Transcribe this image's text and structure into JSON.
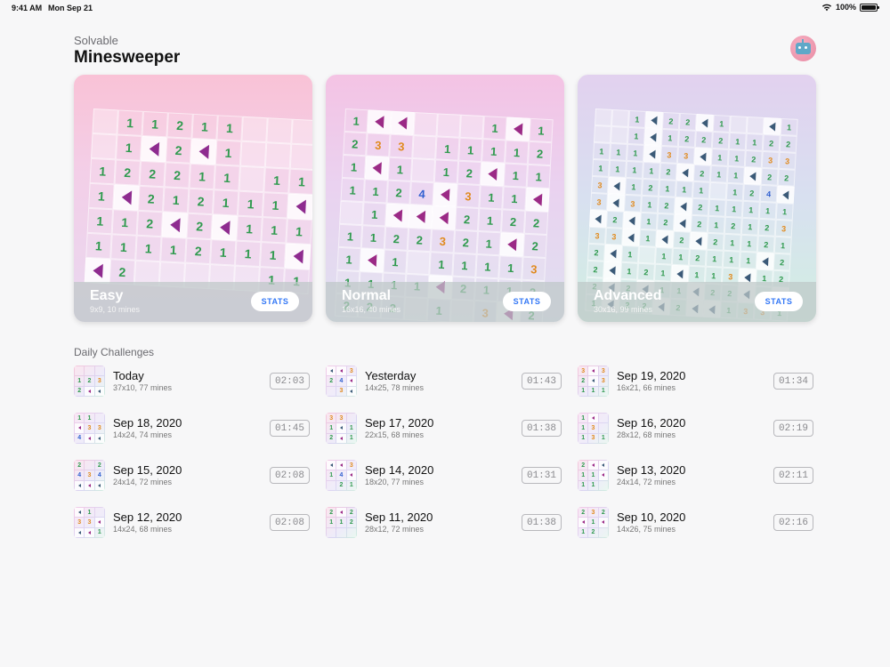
{
  "status_bar": {
    "time": "9:41 AM",
    "date": "Mon Sep 21",
    "battery": "100%"
  },
  "header": {
    "subtitle": "Solvable",
    "title": "Minesweeper"
  },
  "avatar": {
    "icon": "robot-icon"
  },
  "modes": [
    {
      "name": "Easy",
      "detail": "9x9, 10 mines",
      "stats_label": "STATS"
    },
    {
      "name": "Normal",
      "detail": "16x16, 40 mines",
      "stats_label": "STATS"
    },
    {
      "name": "Advanced",
      "detail": "30x16, 99 mines",
      "stats_label": "STATS"
    }
  ],
  "boards": [
    {
      "rows": [
        [
          "",
          "1",
          "1",
          "2",
          "1",
          "1",
          "",
          "",
          ""
        ],
        [
          "",
          "1",
          "F",
          "2",
          "F",
          "1",
          "",
          "",
          ""
        ],
        [
          "1",
          "2",
          "2",
          "2",
          "1",
          "1",
          "",
          "1",
          "1"
        ],
        [
          "1",
          "F",
          "2",
          "1",
          "2",
          "1",
          "1",
          "1",
          "F"
        ],
        [
          "1",
          "1",
          "2",
          "F",
          "2",
          "F",
          "1",
          "1",
          "1"
        ],
        [
          "1",
          "1",
          "1",
          "1",
          "2",
          "1",
          "1",
          "1",
          "F"
        ],
        [
          "F",
          "2",
          "",
          "",
          "",
          "",
          "",
          "1",
          "1"
        ]
      ]
    },
    {
      "rows": [
        [
          "1",
          "F",
          "F",
          "",
          "",
          "",
          "1",
          "F",
          "1"
        ],
        [
          "2",
          "3",
          "3",
          "",
          "1",
          "1",
          "1",
          "1",
          "2"
        ],
        [
          "1",
          "F",
          "1",
          "",
          "1",
          "2",
          "F",
          "1",
          "1"
        ],
        [
          "1",
          "1",
          "2",
          "4",
          "F",
          "3",
          "1",
          "1",
          "F"
        ],
        [
          "",
          "1",
          "F",
          "F",
          "F",
          "2",
          "1",
          "2",
          "2"
        ],
        [
          "1",
          "1",
          "2",
          "2",
          "3",
          "2",
          "1",
          "F",
          "2"
        ],
        [
          "1",
          "F",
          "1",
          "",
          "1",
          "1",
          "1",
          "1",
          "3"
        ],
        [
          "1",
          "1",
          "1",
          "1",
          "F",
          "2",
          "1",
          "1",
          "2"
        ],
        [
          "2",
          "2",
          "2",
          "",
          "1",
          "",
          "3",
          "F",
          "2"
        ]
      ]
    },
    {
      "rows": [
        [
          "",
          "",
          "1",
          "F",
          "2",
          "2",
          "F",
          "1",
          "",
          "",
          "F",
          "1"
        ],
        [
          "",
          "",
          "1",
          "F",
          "1",
          "2",
          "2",
          "2",
          "1",
          "1",
          "2",
          "2"
        ],
        [
          "1",
          "1",
          "1",
          "F",
          "3",
          "3",
          "F",
          "1",
          "1",
          "2",
          "3",
          "3"
        ],
        [
          "1",
          "1",
          "1",
          "1",
          "2",
          "F",
          "2",
          "1",
          "1",
          "F",
          "2",
          "2"
        ],
        [
          "3",
          "F",
          "1",
          "2",
          "1",
          "1",
          "1",
          "",
          "1",
          "2",
          "4",
          "F"
        ],
        [
          "3",
          "F",
          "3",
          "1",
          "2",
          "F",
          "2",
          "1",
          "1",
          "1",
          "1",
          "1"
        ],
        [
          "F",
          "2",
          "F",
          "1",
          "2",
          "F",
          "2",
          "1",
          "2",
          "1",
          "2",
          "3"
        ],
        [
          "3",
          "3",
          "F",
          "1",
          "F",
          "2",
          "F",
          "2",
          "1",
          "1",
          "2",
          "1"
        ],
        [
          "2",
          "F",
          "1",
          "",
          "1",
          "1",
          "2",
          "1",
          "1",
          "1",
          "F",
          "2"
        ],
        [
          "2",
          "F",
          "1",
          "2",
          "1",
          "F",
          "1",
          "1",
          "3",
          "F",
          "1",
          "2"
        ],
        [
          "2",
          "F",
          "2",
          "F",
          "1",
          "1",
          "F",
          "2",
          "2",
          "F",
          "3",
          "F"
        ],
        [
          "1",
          "F",
          "2",
          "2",
          "F",
          "2",
          "F",
          "F",
          "1",
          "3",
          "3",
          "1"
        ]
      ]
    }
  ],
  "daily": {
    "section_title": "Daily Challenges",
    "items": [
      {
        "title": "Today",
        "detail": "37x10, 77 mines",
        "time": "02:03",
        "thumb": [
          "",
          "",
          "",
          "1",
          "2",
          "3",
          "2",
          "F",
          "F"
        ]
      },
      {
        "title": "Yesterday",
        "detail": "14x25, 78 mines",
        "time": "01:43",
        "thumb": [
          "F",
          "F",
          "3",
          "2",
          "4",
          "F",
          "",
          "3",
          "F"
        ]
      },
      {
        "title": "Sep 19, 2020",
        "detail": "16x21, 66 mines",
        "time": "01:34",
        "thumb": [
          "3",
          "F",
          "3",
          "2",
          "F",
          "3",
          "1",
          "1",
          "1"
        ]
      },
      {
        "title": "Sep 18, 2020",
        "detail": "14x24, 74 mines",
        "time": "01:45",
        "thumb": [
          "1",
          "1",
          "",
          "F",
          "3",
          "3",
          "4",
          "F",
          "F"
        ]
      },
      {
        "title": "Sep 17, 2020",
        "detail": "22x15, 68 mines",
        "time": "01:38",
        "thumb": [
          "3",
          "3",
          "",
          "1",
          "F",
          "1",
          "2",
          "F",
          "1"
        ]
      },
      {
        "title": "Sep 16, 2020",
        "detail": "28x12, 68 mines",
        "time": "02:19",
        "thumb": [
          "1",
          "F",
          "",
          "1",
          "3",
          "",
          "1",
          "3",
          "1"
        ]
      },
      {
        "title": "Sep 15, 2020",
        "detail": "24x14, 72 mines",
        "time": "02:08",
        "thumb": [
          "2",
          "",
          "2",
          "4",
          "3",
          "4",
          "F",
          "F",
          "F"
        ]
      },
      {
        "title": "Sep 14, 2020",
        "detail": "18x20, 77 mines",
        "time": "01:31",
        "thumb": [
          "F",
          "F",
          "3",
          "1",
          "4",
          "F",
          "",
          "2",
          "1"
        ]
      },
      {
        "title": "Sep 13, 2020",
        "detail": "24x14, 72 mines",
        "time": "02:11",
        "thumb": [
          "2",
          "F",
          "F",
          "1",
          "1",
          "F",
          "1",
          "1",
          ""
        ]
      },
      {
        "title": "Sep 12, 2020",
        "detail": "14x24, 68 mines",
        "time": "02:08",
        "thumb": [
          "F",
          "1",
          "",
          "3",
          "3",
          "F",
          "F",
          "F",
          "1"
        ]
      },
      {
        "title": "Sep 11, 2020",
        "detail": "28x12, 72 mines",
        "time": "01:38",
        "thumb": [
          "2",
          "F",
          "2",
          "1",
          "1",
          "2",
          "",
          "",
          ""
        ]
      },
      {
        "title": "Sep 10, 2020",
        "detail": "14x26, 75 mines",
        "time": "02:16",
        "thumb": [
          "2",
          "3",
          "2",
          "F",
          "1",
          "F",
          "1",
          "2",
          ""
        ]
      }
    ]
  },
  "colors": {
    "n1": "#2f9a4e",
    "n2": "#2f9a4e",
    "n3": "#e08a1e",
    "n4": "#2f5fd0",
    "flag_easy": "#8e2b8f",
    "flag_normal": "#9b2a86",
    "flag_adv": "#3b5a78",
    "accent": "#3478f6"
  }
}
